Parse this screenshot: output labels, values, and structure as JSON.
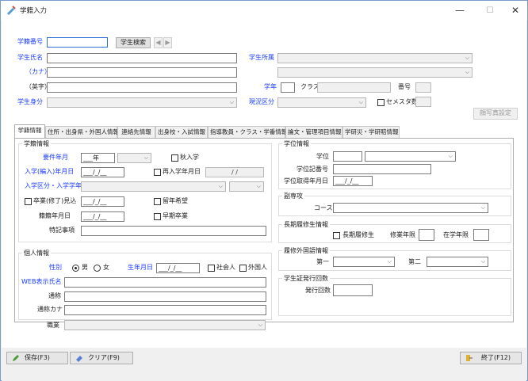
{
  "window": {
    "title": "学籍入力",
    "minimize": "—",
    "maximize": "☐",
    "close": "✕"
  },
  "top": {
    "gakuseki_no_label": "学籍番号",
    "search_button": "学生検索",
    "prev": "◀",
    "next": "▶",
    "name_label": "学生氏名",
    "kana_label": "（カナ）",
    "eiji_label": "（英字）",
    "mibun_label": "学生身分",
    "shozoku_label": "学生所属",
    "gakunen_label": "学年",
    "class_label": "クラス",
    "bango_label": "番号",
    "genkyo_label": "現況区分",
    "semester_label": "セメスタ数",
    "photo_button": "顔写真設定"
  },
  "tabs": [
    {
      "label": "学籍情報"
    },
    {
      "label": "住所・出身県・外国人情報"
    },
    {
      "label": "連絡先情報"
    },
    {
      "label": "出身校・入試情報"
    },
    {
      "label": "指導教員・クラス・学番情報"
    },
    {
      "label": "論文・管理項目情報"
    },
    {
      "label": "学研災・学研賠情報"
    }
  ],
  "gakuseki": {
    "title": "学籍情報",
    "yoken_label": "要件年月",
    "yoken_value": "___年",
    "shu_label": "秋入学",
    "nyugaku_label": "入学(編入)年月日",
    "date_placeholder": "___/_/__",
    "sainyu_label": "再入学年月日",
    "slash_value": "/ /",
    "kubun_label": "入学区分・入学学年",
    "sotsugyo_label": "卒業(修了)見込",
    "ryunen_label": "留年希望",
    "zaiseki_label": "籍籍年月日",
    "souki_label": "早期卒業",
    "tokki_label": "特記事項"
  },
  "kojin": {
    "title": "個人情報",
    "seibetsu_label": "性別",
    "male": "男",
    "female": "女",
    "birth_label": "生年月日",
    "shakaijin_label": "社会人",
    "gaikoku_label": "外国人",
    "web_label": "WEB表示氏名",
    "tsusho_label": "通称",
    "tsusho_kana_label": "通称カナ",
    "shokugyo_label": "職業"
  },
  "gakui": {
    "title": "学位情報",
    "gakui_label": "学位",
    "kiban_label": "学位記番号",
    "date_label": "学位取得年月日"
  },
  "fukusenkou": {
    "title": "副専攻",
    "course_label": "コース名"
  },
  "choki": {
    "title": "長期履修生情報",
    "chk_label": "長期履修生",
    "shugyo_label": "修業年限",
    "zaigaku_label": "在学年限"
  },
  "gaikokugo": {
    "title": "履修外国語情報",
    "first_label": "第一",
    "second_label": "第二"
  },
  "hakko": {
    "title": "学生証発行回数",
    "count_label": "発行回数"
  },
  "footer": {
    "save": "保存(F3)",
    "clear": "クリア(F9)",
    "exit": "終了(F12)"
  }
}
